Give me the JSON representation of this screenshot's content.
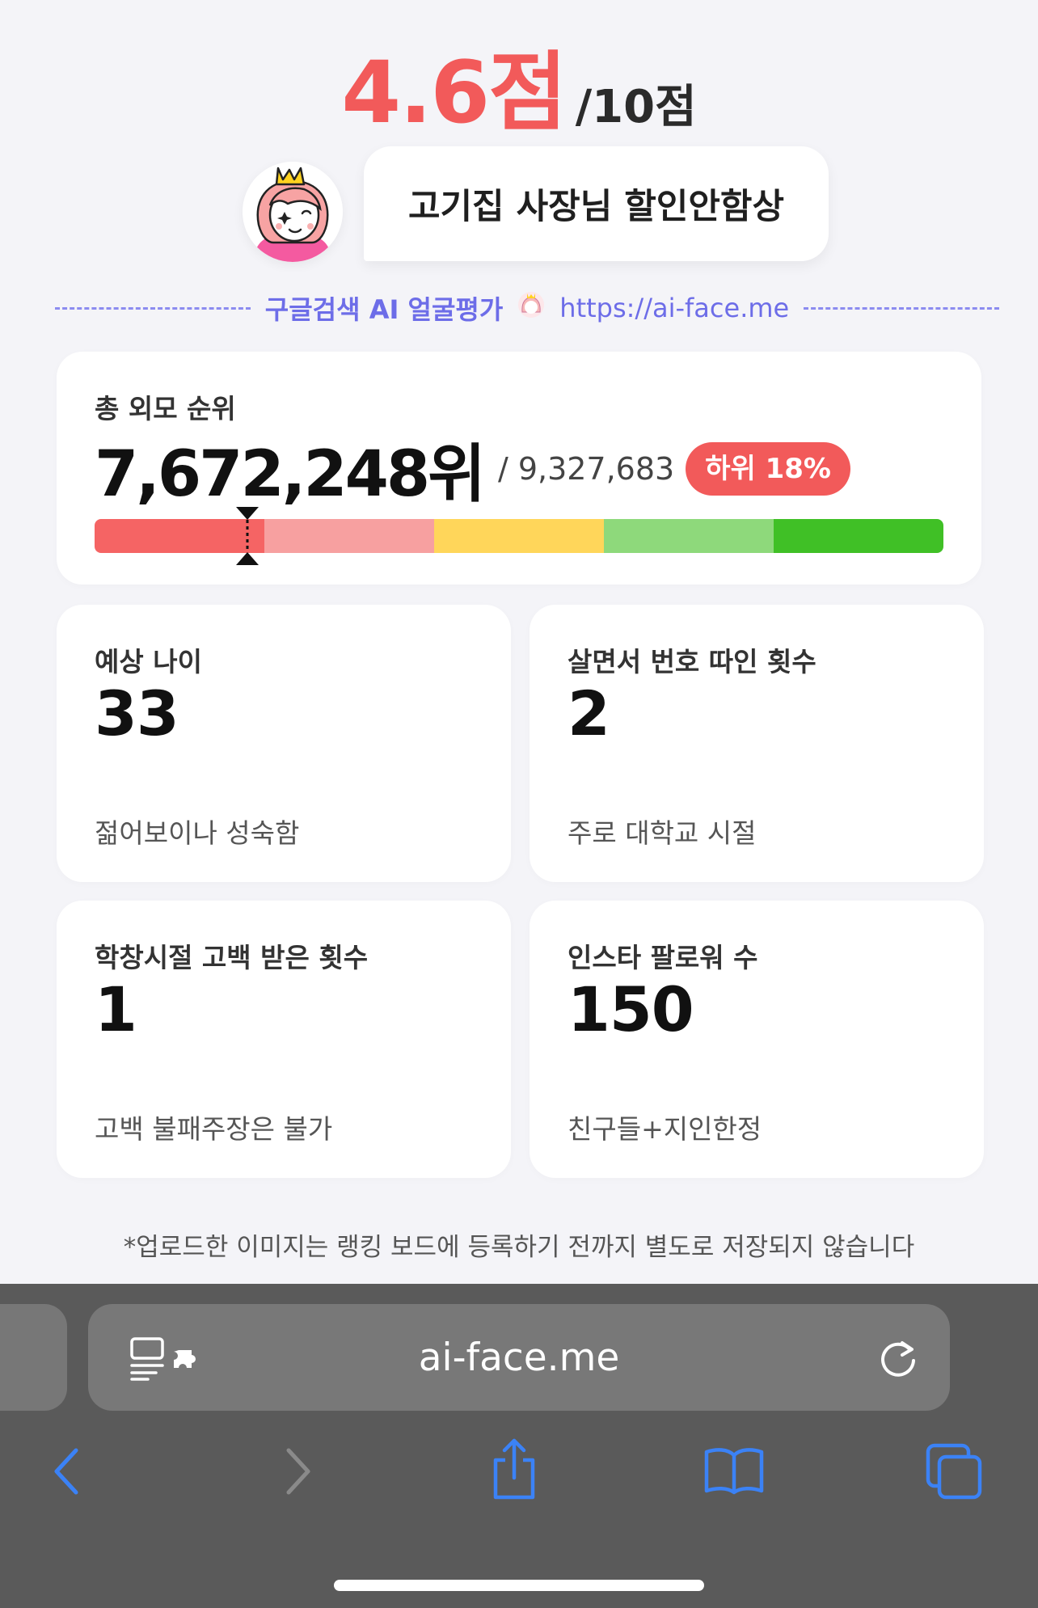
{
  "score": {
    "value": "4.6점",
    "max": "/10점"
  },
  "comment": "고기집 사장님 할인안함상",
  "brand": {
    "label": "구글검색 AI 얼굴평가",
    "url": "https://ai-face.me"
  },
  "rank": {
    "title": "총 외모 순위",
    "value": "7,672,248위",
    "total": "/ 9,327,683",
    "badge": "하위 18%",
    "percentile": 0.18,
    "segment_colors": [
      "#f56464",
      "#f7a0a0",
      "#ffd65a",
      "#8ed97b",
      "#40c026"
    ]
  },
  "stats": [
    {
      "title": "예상 나이",
      "value": "33",
      "desc": "젊어보이나 성숙함"
    },
    {
      "title": "살면서 번호 따인 횟수",
      "value": "2",
      "desc": "주로 대학교 시절"
    },
    {
      "title": "학창시절 고백 받은 횟수",
      "value": "1",
      "desc": "고백 불패주장은 불가"
    },
    {
      "title": "인스타 팔로워 수",
      "value": "150",
      "desc": "친구들+지인한정"
    }
  ],
  "footnote": "*업로드한 이미지는 랭킹 보드에 등록하기 전까지 별도로 저장되지 않습니다",
  "browser": {
    "address": "ai-face.me",
    "accent": "#3b82f6",
    "toolbar": [
      "back-icon",
      "forward-icon",
      "share-icon",
      "bookmarks-icon",
      "tabs-icon"
    ]
  }
}
